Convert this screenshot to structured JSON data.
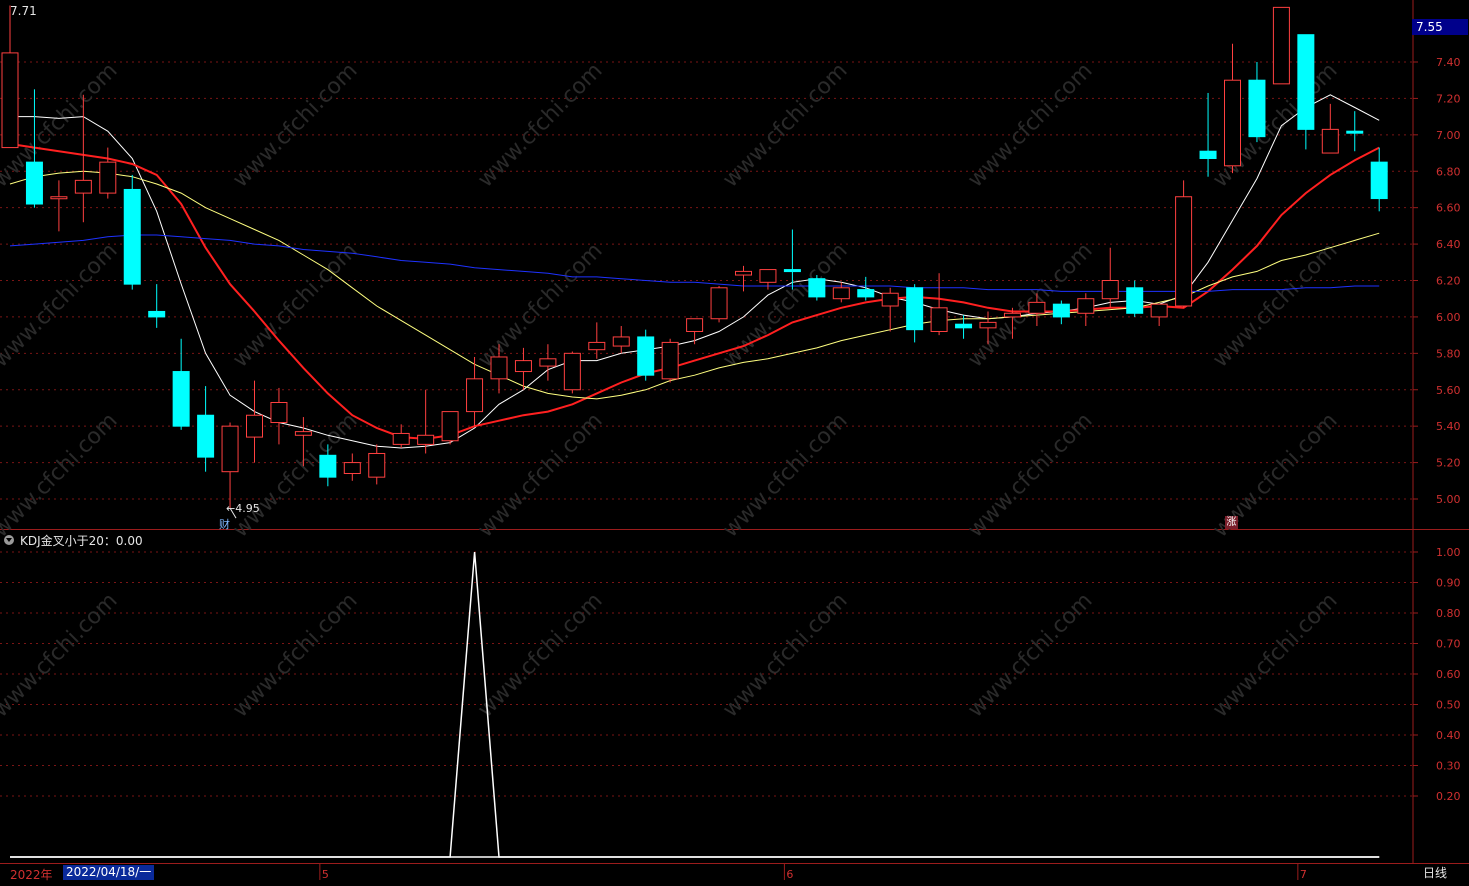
{
  "chart_data": {
    "type": "candlestick",
    "high_label": "7.71",
    "low_label": "←4.95",
    "last_price_tag": "7.55",
    "marker_cai": "财",
    "marker_zhang": "涨",
    "y_ticks": [
      "7.40",
      "7.20",
      "7.00",
      "6.80",
      "6.60",
      "6.40",
      "6.20",
      "6.00",
      "5.80",
      "5.60",
      "5.40",
      "5.20",
      "5.00"
    ],
    "ylim": [
      4.85,
      7.75
    ],
    "candles": [
      {
        "o": 6.93,
        "h": 7.71,
        "l": 6.93,
        "c": 7.45
      },
      {
        "o": 6.85,
        "h": 7.25,
        "l": 6.6,
        "c": 6.62
      },
      {
        "o": 6.65,
        "h": 6.75,
        "l": 6.47,
        "c": 6.66
      },
      {
        "o": 6.68,
        "h": 7.22,
        "l": 6.52,
        "c": 6.75
      },
      {
        "o": 6.68,
        "h": 6.93,
        "l": 6.65,
        "c": 6.85
      },
      {
        "o": 6.7,
        "h": 6.78,
        "l": 6.15,
        "c": 6.18
      },
      {
        "o": 6.03,
        "h": 6.18,
        "l": 5.94,
        "c": 6.0
      },
      {
        "o": 5.7,
        "h": 5.88,
        "l": 5.38,
        "c": 5.4
      },
      {
        "o": 5.46,
        "h": 5.62,
        "l": 5.15,
        "c": 5.23
      },
      {
        "o": 5.15,
        "h": 5.42,
        "l": 4.95,
        "c": 5.4
      },
      {
        "o": 5.34,
        "h": 5.65,
        "l": 5.2,
        "c": 5.46
      },
      {
        "o": 5.42,
        "h": 5.61,
        "l": 5.3,
        "c": 5.53
      },
      {
        "o": 5.35,
        "h": 5.45,
        "l": 5.18,
        "c": 5.37
      },
      {
        "o": 5.24,
        "h": 5.3,
        "l": 5.07,
        "c": 5.12
      },
      {
        "o": 5.14,
        "h": 5.25,
        "l": 5.1,
        "c": 5.2
      },
      {
        "o": 5.12,
        "h": 5.3,
        "l": 5.08,
        "c": 5.25
      },
      {
        "o": 5.3,
        "h": 5.41,
        "l": 5.28,
        "c": 5.36
      },
      {
        "o": 5.3,
        "h": 5.6,
        "l": 5.25,
        "c": 5.35
      },
      {
        "o": 5.32,
        "h": 5.45,
        "l": 5.3,
        "c": 5.48
      },
      {
        "o": 5.48,
        "h": 5.78,
        "l": 5.4,
        "c": 5.66
      },
      {
        "o": 5.66,
        "h": 5.85,
        "l": 5.58,
        "c": 5.78
      },
      {
        "o": 5.7,
        "h": 5.83,
        "l": 5.6,
        "c": 5.76
      },
      {
        "o": 5.73,
        "h": 5.85,
        "l": 5.65,
        "c": 5.77
      },
      {
        "o": 5.6,
        "h": 5.81,
        "l": 5.58,
        "c": 5.8
      },
      {
        "o": 5.82,
        "h": 5.97,
        "l": 5.77,
        "c": 5.86
      },
      {
        "o": 5.84,
        "h": 5.95,
        "l": 5.8,
        "c": 5.89
      },
      {
        "o": 5.89,
        "h": 5.93,
        "l": 5.65,
        "c": 5.68
      },
      {
        "o": 5.66,
        "h": 5.88,
        "l": 5.64,
        "c": 5.86
      },
      {
        "o": 5.92,
        "h": 5.99,
        "l": 5.85,
        "c": 5.99
      },
      {
        "o": 5.99,
        "h": 6.17,
        "l": 5.97,
        "c": 6.16
      },
      {
        "o": 6.23,
        "h": 6.28,
        "l": 6.14,
        "c": 6.25
      },
      {
        "o": 6.19,
        "h": 6.26,
        "l": 6.15,
        "c": 6.26
      },
      {
        "o": 6.26,
        "h": 6.48,
        "l": 6.15,
        "c": 6.25
      },
      {
        "o": 6.21,
        "h": 6.23,
        "l": 6.09,
        "c": 6.11
      },
      {
        "o": 6.1,
        "h": 6.19,
        "l": 6.08,
        "c": 6.16
      },
      {
        "o": 6.15,
        "h": 6.22,
        "l": 6.09,
        "c": 6.11
      },
      {
        "o": 6.06,
        "h": 6.16,
        "l": 5.92,
        "c": 6.13
      },
      {
        "o": 6.16,
        "h": 6.18,
        "l": 5.86,
        "c": 5.93
      },
      {
        "o": 5.92,
        "h": 6.24,
        "l": 5.9,
        "c": 6.05
      },
      {
        "o": 5.96,
        "h": 6.01,
        "l": 5.88,
        "c": 5.94
      },
      {
        "o": 5.94,
        "h": 6.03,
        "l": 5.85,
        "c": 5.97
      },
      {
        "o": 6.0,
        "h": 6.05,
        "l": 5.88,
        "c": 6.02
      },
      {
        "o": 6.02,
        "h": 6.13,
        "l": 5.95,
        "c": 6.08
      },
      {
        "o": 6.07,
        "h": 6.09,
        "l": 5.96,
        "c": 6.0
      },
      {
        "o": 6.02,
        "h": 6.13,
        "l": 5.95,
        "c": 6.1
      },
      {
        "o": 6.1,
        "h": 6.38,
        "l": 6.05,
        "c": 6.2
      },
      {
        "o": 6.16,
        "h": 6.2,
        "l": 6.0,
        "c": 6.02
      },
      {
        "o": 6.0,
        "h": 6.05,
        "l": 5.95,
        "c": 6.07
      },
      {
        "o": 6.06,
        "h": 6.75,
        "l": 6.05,
        "c": 6.66
      },
      {
        "o": 6.91,
        "h": 7.23,
        "l": 6.77,
        "c": 6.87
      },
      {
        "o": 6.83,
        "h": 7.5,
        "l": 6.79,
        "c": 7.3
      },
      {
        "o": 7.3,
        "h": 7.4,
        "l": 6.96,
        "c": 6.99
      },
      {
        "o": 7.28,
        "h": 7.7,
        "l": 7.28,
        "c": 7.7
      },
      {
        "o": 7.55,
        "h": 7.55,
        "l": 6.92,
        "c": 7.03
      },
      {
        "o": 6.9,
        "h": 7.17,
        "l": 6.9,
        "c": 7.03
      },
      {
        "o": 7.02,
        "h": 7.13,
        "l": 6.91,
        "c": 7.01
      },
      {
        "o": 6.85,
        "h": 6.93,
        "l": 6.58,
        "c": 6.65
      }
    ],
    "ma_series": [
      {
        "color": "#ffffff",
        "values": [
          7.1,
          7.1,
          7.09,
          7.1,
          7.02,
          6.87,
          6.58,
          6.18,
          5.8,
          5.57,
          5.48,
          5.42,
          5.39,
          5.35,
          5.32,
          5.29,
          5.28,
          5.29,
          5.31,
          5.39,
          5.52,
          5.6,
          5.71,
          5.76,
          5.76,
          5.8,
          5.82,
          5.84,
          5.87,
          5.92,
          6.0,
          6.12,
          6.19,
          6.21,
          6.19,
          6.16,
          6.11,
          6.08,
          6.04,
          6.01,
          5.99,
          6.0,
          6.02,
          6.03,
          6.05,
          6.08,
          6.09,
          6.07,
          6.12,
          6.3,
          6.53,
          6.76,
          7.05,
          7.15,
          7.22,
          7.15,
          7.08
        ]
      },
      {
        "color": "#ff2020",
        "values": [
          6.95,
          6.93,
          6.91,
          6.89,
          6.87,
          6.84,
          6.78,
          6.62,
          6.38,
          6.18,
          6.03,
          5.87,
          5.72,
          5.58,
          5.46,
          5.39,
          5.34,
          5.33,
          5.35,
          5.4,
          5.43,
          5.46,
          5.48,
          5.52,
          5.58,
          5.64,
          5.69,
          5.72,
          5.76,
          5.8,
          5.84,
          5.9,
          5.97,
          6.01,
          6.05,
          6.08,
          6.1,
          6.11,
          6.1,
          6.08,
          6.05,
          6.03,
          6.03,
          6.03,
          6.04,
          6.05,
          6.05,
          6.06,
          6.05,
          6.14,
          6.26,
          6.39,
          6.56,
          6.68,
          6.78,
          6.86,
          6.93
        ]
      },
      {
        "color": "#ffff80",
        "values": [
          6.73,
          6.77,
          6.79,
          6.8,
          6.79,
          6.77,
          6.73,
          6.68,
          6.6,
          6.54,
          6.48,
          6.42,
          6.34,
          6.26,
          6.16,
          6.06,
          5.98,
          5.9,
          5.82,
          5.74,
          5.68,
          5.62,
          5.58,
          5.56,
          5.55,
          5.57,
          5.6,
          5.65,
          5.68,
          5.72,
          5.75,
          5.77,
          5.8,
          5.83,
          5.87,
          5.9,
          5.93,
          5.96,
          5.98,
          5.99,
          5.99,
          6.0,
          6.01,
          6.02,
          6.03,
          6.04,
          6.05,
          6.08,
          6.11,
          6.17,
          6.22,
          6.25,
          6.31,
          6.34,
          6.38,
          6.42,
          6.46
        ]
      },
      {
        "color": "#1e32ff",
        "values": [
          6.39,
          6.4,
          6.41,
          6.42,
          6.44,
          6.45,
          6.45,
          6.44,
          6.43,
          6.42,
          6.4,
          6.39,
          6.37,
          6.36,
          6.35,
          6.33,
          6.31,
          6.3,
          6.29,
          6.27,
          6.26,
          6.25,
          6.24,
          6.22,
          6.22,
          6.21,
          6.2,
          6.19,
          6.19,
          6.18,
          6.17,
          6.17,
          6.17,
          6.17,
          6.17,
          6.17,
          6.17,
          6.16,
          6.16,
          6.16,
          6.15,
          6.15,
          6.15,
          6.14,
          6.14,
          6.14,
          6.14,
          6.14,
          6.14,
          6.14,
          6.15,
          6.15,
          6.15,
          6.16,
          6.16,
          6.17,
          6.17
        ]
      }
    ],
    "indicator": {
      "title": "KDJ金叉小于20：0.00",
      "y_ticks": [
        "1.00",
        "0.90",
        "0.80",
        "0.70",
        "0.60",
        "0.50",
        "0.40",
        "0.30",
        "0.20"
      ],
      "ylim": [
        0,
        1
      ],
      "values": [
        0,
        0,
        0,
        0,
        0,
        0,
        0,
        0,
        0,
        0,
        0,
        0,
        0,
        0,
        0,
        0,
        0,
        0,
        0,
        1,
        0,
        0,
        0,
        0,
        0,
        0,
        0,
        0,
        0,
        0,
        0,
        0,
        0,
        0,
        0,
        0,
        0,
        0,
        0,
        0,
        0,
        0,
        0,
        0,
        0,
        0,
        0,
        0,
        0,
        0,
        0,
        0,
        0,
        0,
        0,
        0,
        0
      ]
    },
    "x_axis": {
      "year_label": "2022年",
      "cursor_date": "2022/04/18/一",
      "month_labels": [
        {
          "label": "5",
          "index": 13
        },
        {
          "label": "6",
          "index": 32
        },
        {
          "label": "7",
          "index": 53
        }
      ]
    },
    "period_label": "日线",
    "watermark": "www.cfchi.com",
    "colors": {
      "up": "#ff4040",
      "down": "#00ffff",
      "grid": "#7a1515",
      "axis": "#9b1c1c"
    }
  }
}
